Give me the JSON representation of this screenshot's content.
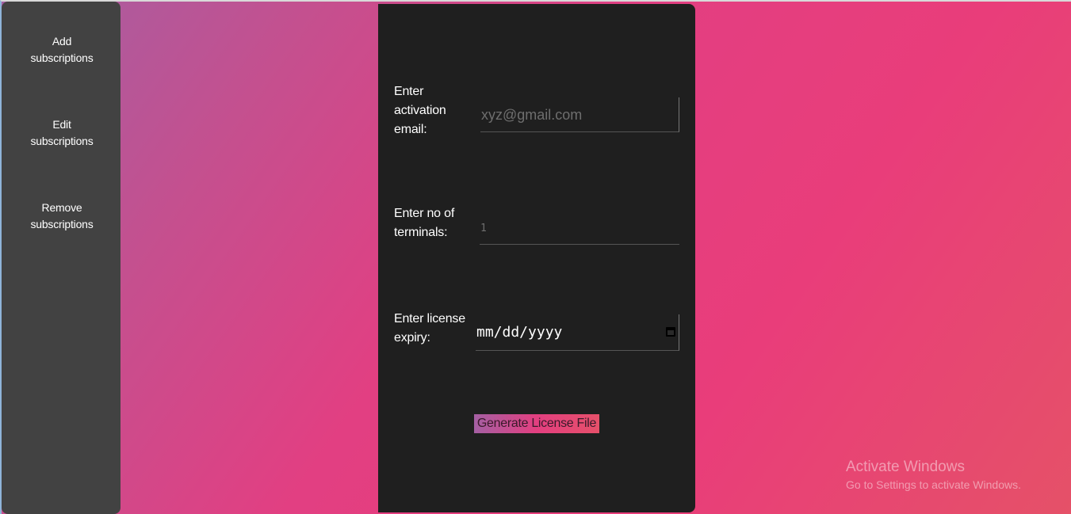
{
  "sidebar": {
    "items": [
      {
        "line1": "Add",
        "line2": "subscriptions"
      },
      {
        "line1": "Edit",
        "line2": "subscriptions"
      },
      {
        "line1": "Remove",
        "line2": "subscriptions"
      }
    ]
  },
  "form": {
    "email": {
      "label_lines": [
        "Enter",
        "activation",
        "email:"
      ],
      "placeholder": "xyz@gmail.com"
    },
    "terminals": {
      "label_lines": [
        "Enter no of",
        "terminals:"
      ],
      "placeholder": "1"
    },
    "expiry": {
      "label_lines": [
        "Enter license",
        "expiry:"
      ],
      "value": "mm/dd/yyyy",
      "icon": "calendar-icon"
    },
    "submit_label": "Generate License File"
  },
  "watermark": {
    "title": "Activate Windows",
    "subtitle": "Go to Settings to activate Windows."
  },
  "colors": {
    "sidebar_bg": "#424242",
    "card_bg": "#1f1f1f",
    "gradient_start": "#a45fa3",
    "gradient_mid": "#e23f82",
    "gradient_end": "#e55168"
  }
}
